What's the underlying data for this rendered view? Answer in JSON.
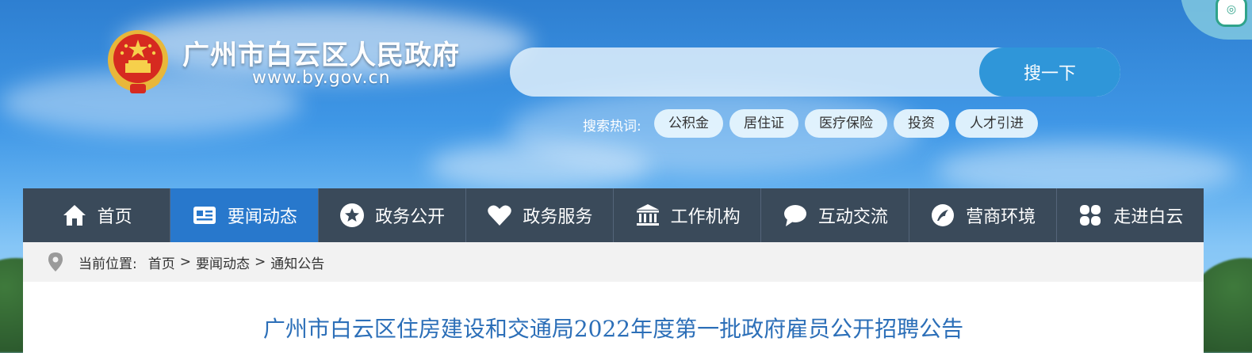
{
  "header": {
    "site_name": "广州市白云区人民政府",
    "site_url": "www.by.gov.cn"
  },
  "search": {
    "placeholder": "",
    "button_label": "搜一下",
    "hot_label": "搜索热词:",
    "hot_tags": [
      "公积金",
      "居住证",
      "医疗保险",
      "投资",
      "人才引进"
    ]
  },
  "nav": {
    "items": [
      {
        "label": "首页",
        "icon": "home-icon"
      },
      {
        "label": "要闻动态",
        "icon": "news-icon",
        "active": true
      },
      {
        "label": "政务公开",
        "icon": "star-icon"
      },
      {
        "label": "政务服务",
        "icon": "heart-icon"
      },
      {
        "label": "工作机构",
        "icon": "institution-icon"
      },
      {
        "label": "互动交流",
        "icon": "chat-icon"
      },
      {
        "label": "营商环境",
        "icon": "business-icon"
      },
      {
        "label": "走进白云",
        "icon": "clover-icon"
      }
    ]
  },
  "breadcrumb": {
    "label": "当前位置:",
    "items": [
      "首页",
      "要闻动态",
      "通知公告"
    ],
    "separator": ">"
  },
  "article": {
    "title": "广州市白云区住房建设和交通局2022年度第一批政府雇员公开招聘公告"
  },
  "colors": {
    "nav_bg": "#3a4a5a",
    "nav_active": "#2878cc",
    "title_color": "#2c6fb8",
    "search_button": "#2f96d9"
  }
}
